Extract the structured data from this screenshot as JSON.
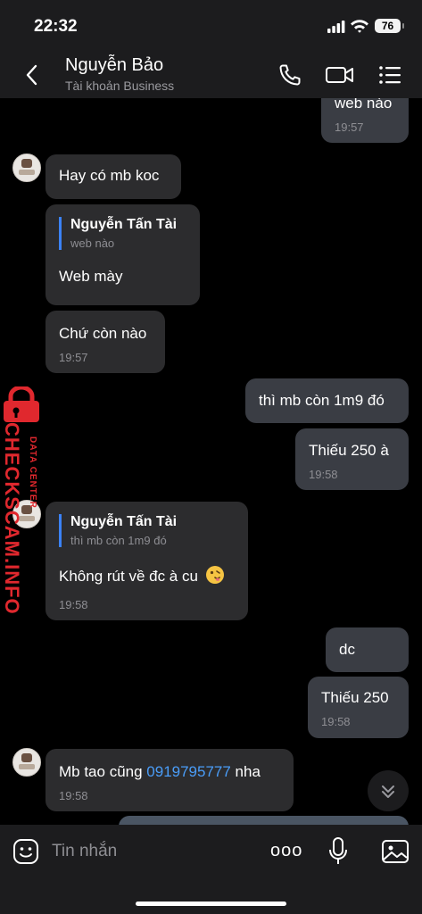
{
  "status": {
    "time": "22:32",
    "battery": "76"
  },
  "header": {
    "name": "Nguyễn Bảo",
    "subtitle": "Tài khoản Business"
  },
  "messages": {
    "m0": {
      "text": "web nào",
      "time": "19:57"
    },
    "m1": {
      "text": "Hay có mb koc"
    },
    "m2": {
      "reply_name": "Nguyễn Tấn Tài",
      "reply_text": "web nào",
      "text": "Web mày"
    },
    "m3": {
      "text": "Chứ còn nào",
      "time": "19:57"
    },
    "m4": {
      "text": "thì mb còn 1m9 đó"
    },
    "m5": {
      "text": "Thiếu 250 à",
      "time": "19:58"
    },
    "m6": {
      "reply_name": "Nguyễn Tấn Tài",
      "reply_text": "thì mb còn 1m9 đó",
      "text": "Không rút về đc à cu",
      "time": "19:58"
    },
    "m7": {
      "text": "dc"
    },
    "m8": {
      "text": "Thiếu 250",
      "time": "19:58"
    },
    "m9": {
      "text_before": "Mb tao cũng ",
      "phone": "0919795777",
      "text_after": " nha",
      "time": "19:58"
    }
  },
  "watermark": {
    "brand": "CHECKSCAM.INFO",
    "tag": "DATA CENTER"
  },
  "input": {
    "placeholder": "Tin nhắn",
    "more_label": "ooo"
  },
  "icons": {
    "back": "chevron-left-icon",
    "call": "phone-icon",
    "video": "video-camera-icon",
    "menu": "list-icon",
    "sticker": "sticker-icon",
    "mic": "microphone-icon",
    "image": "image-icon",
    "scroll": "chevron-double-down-icon",
    "lock": "padlock-icon"
  },
  "colors": {
    "accent": "#3b82f6",
    "link": "#4a9df8",
    "watermark": "#e0282e",
    "bubble_in": "#2c2c2e",
    "bubble_out": "#3a3d44"
  }
}
